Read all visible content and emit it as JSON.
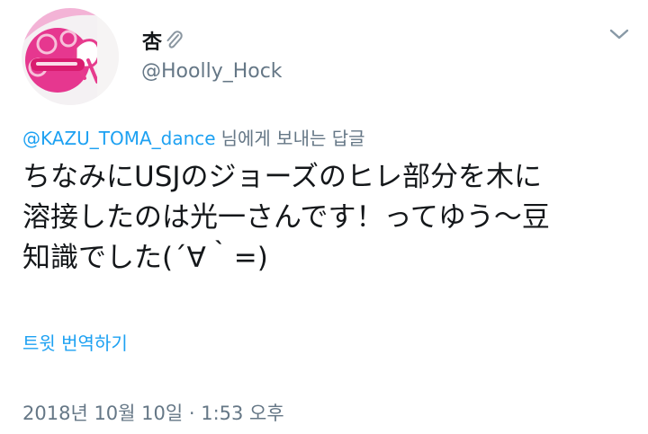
{
  "author": {
    "display_name": "杏",
    "handle": "@Hoolly_Hock"
  },
  "reply": {
    "mention": "@KAZU_TOMA_dance",
    "suffix": "님에게 보내는 답글"
  },
  "tweet": {
    "lines": [
      "ちなみにUSJのジョーズのヒレ部分を木に",
      "溶接したのは光一さんです！ってゆう〜豆",
      "知識でした(´∀｀=)"
    ]
  },
  "actions": {
    "translate_label": "트윗 번역하기"
  },
  "meta": {
    "timestamp": "2018년 10월 10일 · 1:53 오후"
  },
  "icons": {
    "avatar": "avatar-image",
    "name_badge": "paperclip-icon",
    "menu": "chevron-down-icon"
  },
  "colors": {
    "link": "#1da1f2",
    "secondary": "#657786",
    "text": "#14171a"
  }
}
